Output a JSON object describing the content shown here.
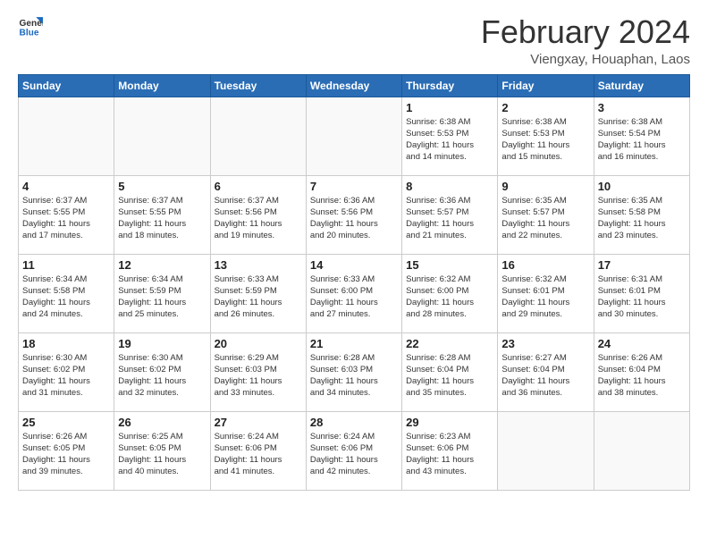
{
  "logo": {
    "general": "General",
    "blue": "Blue"
  },
  "header": {
    "month": "February 2024",
    "location": "Viengxay, Houaphan, Laos"
  },
  "weekdays": [
    "Sunday",
    "Monday",
    "Tuesday",
    "Wednesday",
    "Thursday",
    "Friday",
    "Saturday"
  ],
  "weeks": [
    [
      {
        "day": "",
        "info": ""
      },
      {
        "day": "",
        "info": ""
      },
      {
        "day": "",
        "info": ""
      },
      {
        "day": "",
        "info": ""
      },
      {
        "day": "1",
        "info": "Sunrise: 6:38 AM\nSunset: 5:53 PM\nDaylight: 11 hours\nand 14 minutes."
      },
      {
        "day": "2",
        "info": "Sunrise: 6:38 AM\nSunset: 5:53 PM\nDaylight: 11 hours\nand 15 minutes."
      },
      {
        "day": "3",
        "info": "Sunrise: 6:38 AM\nSunset: 5:54 PM\nDaylight: 11 hours\nand 16 minutes."
      }
    ],
    [
      {
        "day": "4",
        "info": "Sunrise: 6:37 AM\nSunset: 5:55 PM\nDaylight: 11 hours\nand 17 minutes."
      },
      {
        "day": "5",
        "info": "Sunrise: 6:37 AM\nSunset: 5:55 PM\nDaylight: 11 hours\nand 18 minutes."
      },
      {
        "day": "6",
        "info": "Sunrise: 6:37 AM\nSunset: 5:56 PM\nDaylight: 11 hours\nand 19 minutes."
      },
      {
        "day": "7",
        "info": "Sunrise: 6:36 AM\nSunset: 5:56 PM\nDaylight: 11 hours\nand 20 minutes."
      },
      {
        "day": "8",
        "info": "Sunrise: 6:36 AM\nSunset: 5:57 PM\nDaylight: 11 hours\nand 21 minutes."
      },
      {
        "day": "9",
        "info": "Sunrise: 6:35 AM\nSunset: 5:57 PM\nDaylight: 11 hours\nand 22 minutes."
      },
      {
        "day": "10",
        "info": "Sunrise: 6:35 AM\nSunset: 5:58 PM\nDaylight: 11 hours\nand 23 minutes."
      }
    ],
    [
      {
        "day": "11",
        "info": "Sunrise: 6:34 AM\nSunset: 5:58 PM\nDaylight: 11 hours\nand 24 minutes."
      },
      {
        "day": "12",
        "info": "Sunrise: 6:34 AM\nSunset: 5:59 PM\nDaylight: 11 hours\nand 25 minutes."
      },
      {
        "day": "13",
        "info": "Sunrise: 6:33 AM\nSunset: 5:59 PM\nDaylight: 11 hours\nand 26 minutes."
      },
      {
        "day": "14",
        "info": "Sunrise: 6:33 AM\nSunset: 6:00 PM\nDaylight: 11 hours\nand 27 minutes."
      },
      {
        "day": "15",
        "info": "Sunrise: 6:32 AM\nSunset: 6:00 PM\nDaylight: 11 hours\nand 28 minutes."
      },
      {
        "day": "16",
        "info": "Sunrise: 6:32 AM\nSunset: 6:01 PM\nDaylight: 11 hours\nand 29 minutes."
      },
      {
        "day": "17",
        "info": "Sunrise: 6:31 AM\nSunset: 6:01 PM\nDaylight: 11 hours\nand 30 minutes."
      }
    ],
    [
      {
        "day": "18",
        "info": "Sunrise: 6:30 AM\nSunset: 6:02 PM\nDaylight: 11 hours\nand 31 minutes."
      },
      {
        "day": "19",
        "info": "Sunrise: 6:30 AM\nSunset: 6:02 PM\nDaylight: 11 hours\nand 32 minutes."
      },
      {
        "day": "20",
        "info": "Sunrise: 6:29 AM\nSunset: 6:03 PM\nDaylight: 11 hours\nand 33 minutes."
      },
      {
        "day": "21",
        "info": "Sunrise: 6:28 AM\nSunset: 6:03 PM\nDaylight: 11 hours\nand 34 minutes."
      },
      {
        "day": "22",
        "info": "Sunrise: 6:28 AM\nSunset: 6:04 PM\nDaylight: 11 hours\nand 35 minutes."
      },
      {
        "day": "23",
        "info": "Sunrise: 6:27 AM\nSunset: 6:04 PM\nDaylight: 11 hours\nand 36 minutes."
      },
      {
        "day": "24",
        "info": "Sunrise: 6:26 AM\nSunset: 6:04 PM\nDaylight: 11 hours\nand 38 minutes."
      }
    ],
    [
      {
        "day": "25",
        "info": "Sunrise: 6:26 AM\nSunset: 6:05 PM\nDaylight: 11 hours\nand 39 minutes."
      },
      {
        "day": "26",
        "info": "Sunrise: 6:25 AM\nSunset: 6:05 PM\nDaylight: 11 hours\nand 40 minutes."
      },
      {
        "day": "27",
        "info": "Sunrise: 6:24 AM\nSunset: 6:06 PM\nDaylight: 11 hours\nand 41 minutes."
      },
      {
        "day": "28",
        "info": "Sunrise: 6:24 AM\nSunset: 6:06 PM\nDaylight: 11 hours\nand 42 minutes."
      },
      {
        "day": "29",
        "info": "Sunrise: 6:23 AM\nSunset: 6:06 PM\nDaylight: 11 hours\nand 43 minutes."
      },
      {
        "day": "",
        "info": ""
      },
      {
        "day": "",
        "info": ""
      }
    ]
  ]
}
